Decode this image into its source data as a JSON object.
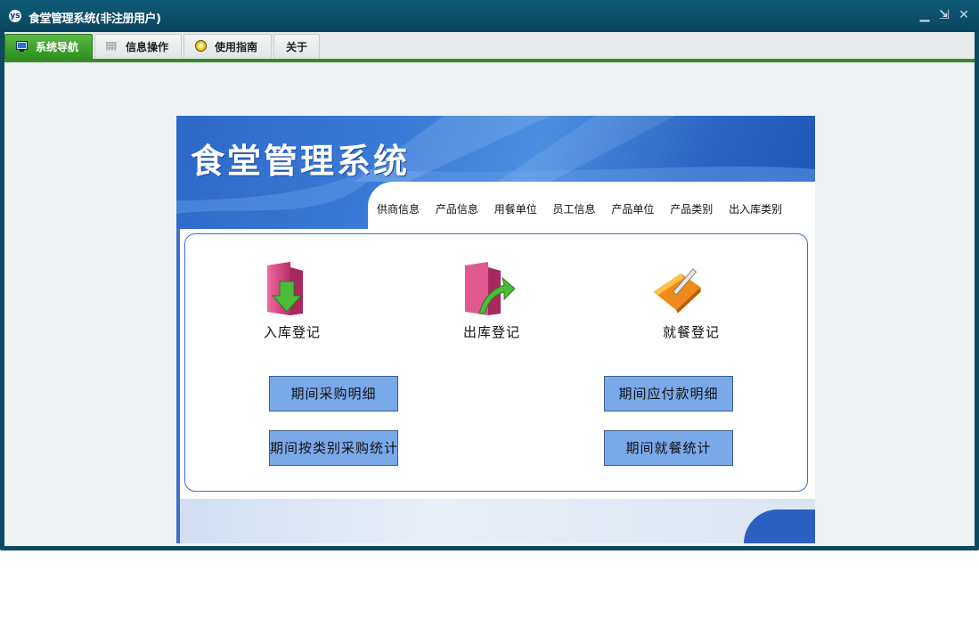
{
  "window": {
    "title": "食堂管理系统(非注册用户)",
    "controls": {
      "minimize": "▁",
      "restore": "⇲",
      "close": "✕"
    }
  },
  "menu": {
    "tabs": [
      {
        "label": "系统导航",
        "active": true,
        "icon": "monitor-icon"
      },
      {
        "label": "信息操作",
        "active": false,
        "icon": "grid-icon"
      },
      {
        "label": "使用指南",
        "active": false,
        "icon": "guide-icon"
      },
      {
        "label": "关于",
        "active": false,
        "icon": ""
      }
    ]
  },
  "banner": {
    "title": "食堂管理系统",
    "links": [
      "供商信息",
      "产品信息",
      "用餐单位",
      "员工信息",
      "产品单位",
      "产品类别",
      "出入库类别"
    ]
  },
  "shortcuts": [
    {
      "label": "入库登记",
      "icon": "inbound-folder-icon"
    },
    {
      "label": "出库登记",
      "icon": "outbound-folder-icon"
    },
    {
      "label": "就餐登记",
      "icon": "dining-folder-icon"
    }
  ],
  "buttons": {
    "purchase_detail": "期间采购明细",
    "payable_detail": "期间应付款明细",
    "category_purchase_stats": "期间按类别采购统计",
    "dining_stats": "期间就餐统计"
  },
  "colors": {
    "title_bar": "#0b4560",
    "active_tab": "#3a9a2a",
    "banner_blue": "#2d67c8",
    "button_fill": "#7aa9ea"
  }
}
